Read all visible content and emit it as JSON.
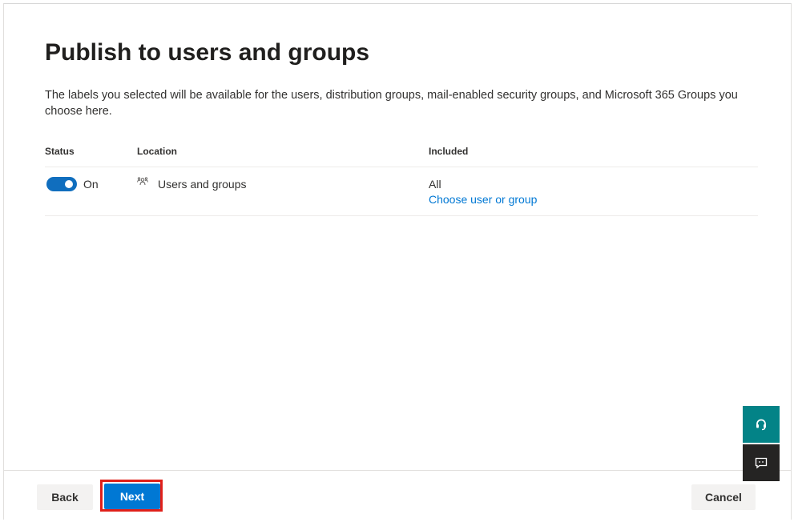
{
  "page": {
    "title": "Publish to users and groups",
    "description": "The labels you selected will be available for the users, distribution groups, mail-enabled security groups, and Microsoft 365 Groups you choose here."
  },
  "table": {
    "headers": {
      "status": "Status",
      "location": "Location",
      "included": "Included"
    },
    "rows": [
      {
        "status_on": true,
        "status_label": "On",
        "location_icon": "users-groups-icon",
        "location": "Users and groups",
        "included": "All",
        "included_link": "Choose user or group"
      }
    ]
  },
  "footer": {
    "back_label": "Back",
    "next_label": "Next",
    "cancel_label": "Cancel"
  },
  "side_buttons": {
    "help_icon": "help-headset-icon",
    "feedback_icon": "feedback-icon"
  },
  "colors": {
    "accent": "#0078d4",
    "toggle_on": "#106ebe",
    "highlight": "#e0201a",
    "help_bg": "#038387",
    "feedback_bg": "#252423"
  }
}
